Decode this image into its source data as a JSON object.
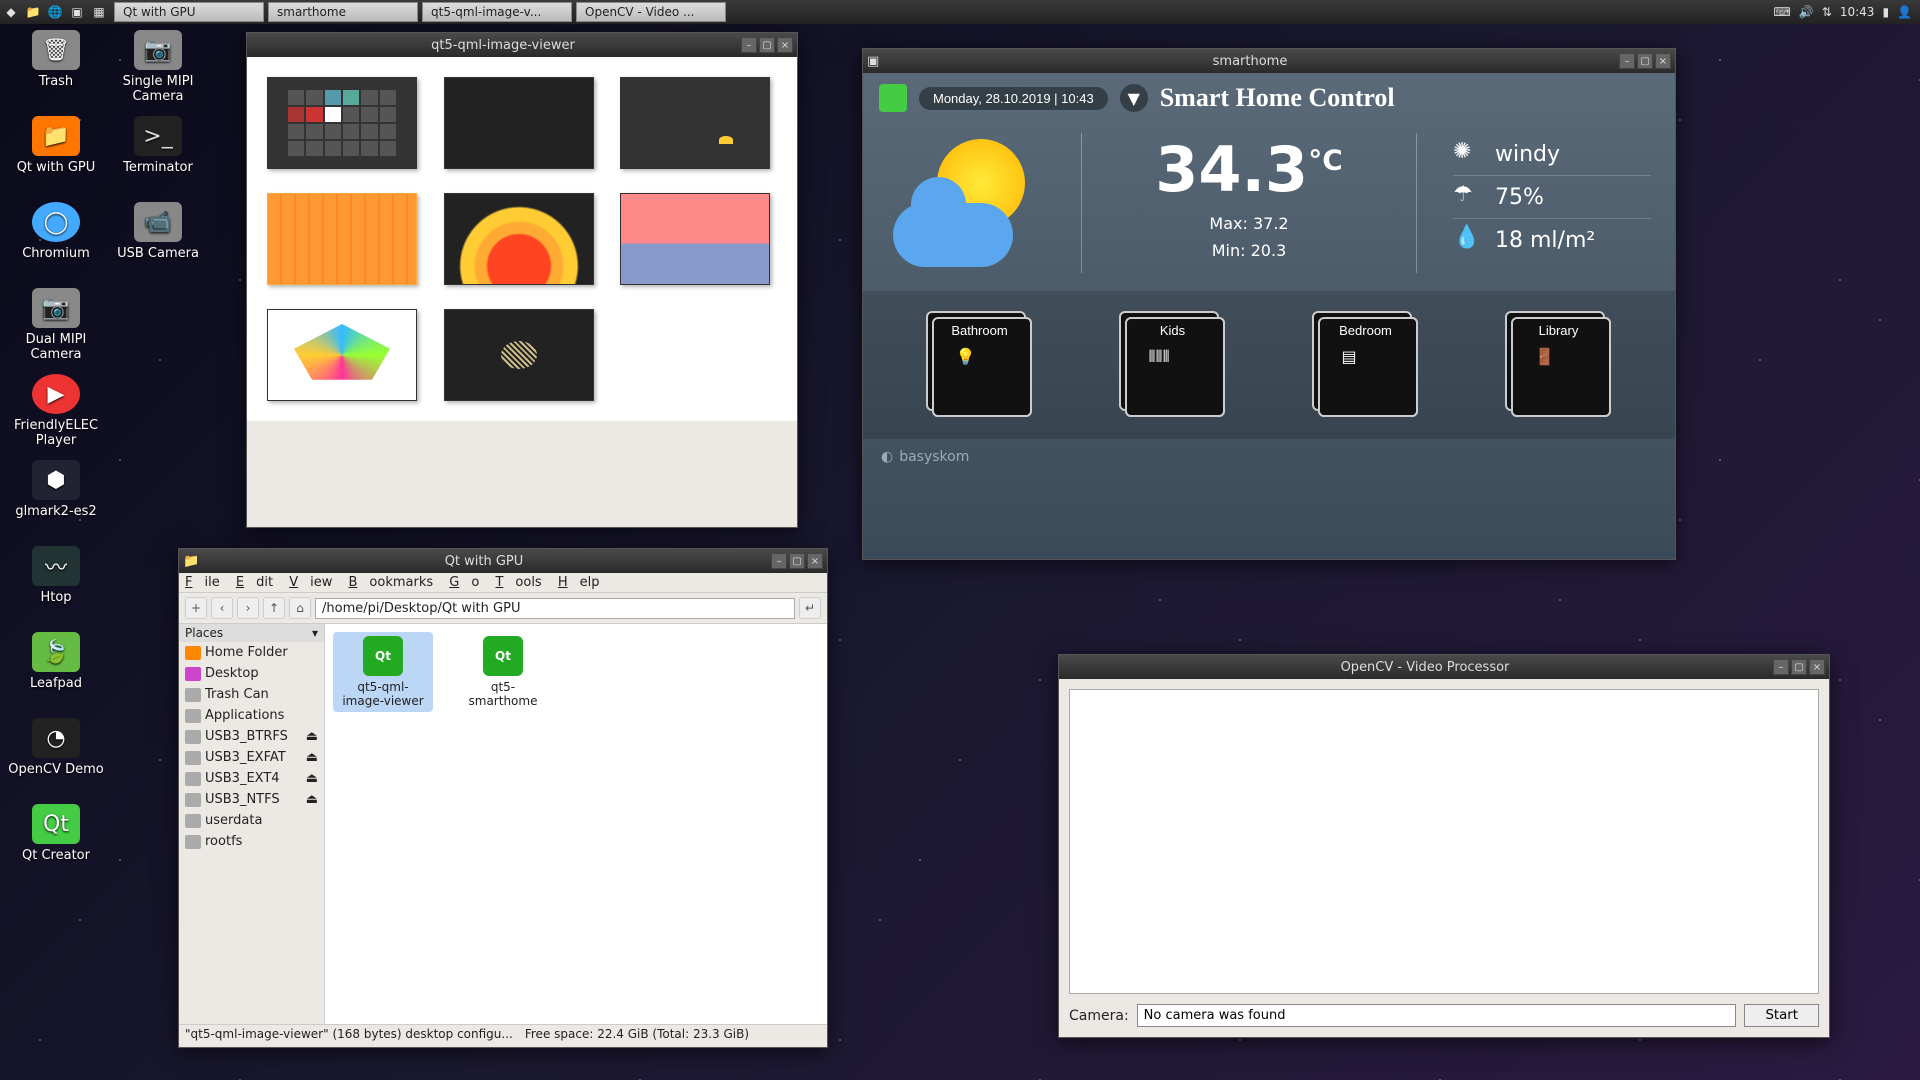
{
  "taskbar": {
    "tasks": [
      "Qt with GPU",
      "smarthome",
      "qt5-qml-image-v...",
      "OpenCV - Video ..."
    ],
    "clock": "10:43"
  },
  "desktop": {
    "icons": [
      "Trash",
      "Single MIPI Camera",
      "Qt with GPU",
      "Terminator",
      "Chromium",
      "USB Camera",
      "Dual MIPI Camera",
      "",
      "FriendlyELEC Player",
      "",
      "glmark2-es2",
      "",
      "Htop",
      "",
      "Leafpad",
      "",
      "OpenCV Demo",
      "",
      "Qt Creator",
      ""
    ]
  },
  "viewer": {
    "title": "qt5-qml-image-viewer"
  },
  "fm": {
    "title": "Qt with GPU",
    "menus": [
      "File",
      "Edit",
      "View",
      "Bookmarks",
      "Go",
      "Tools",
      "Help"
    ],
    "path": "/home/pi/Desktop/Qt with GPU",
    "places_hdr": "Places",
    "places": [
      "Home Folder",
      "Desktop",
      "Trash Can",
      "Applications",
      "USB3_BTRFS",
      "USB3_EXFAT",
      "USB3_EXT4",
      "USB3_NTFS",
      "userdata",
      "rootfs"
    ],
    "files": [
      {
        "name": "qt5-qml-image-viewer",
        "sel": true
      },
      {
        "name": "qt5-smarthome",
        "sel": false
      }
    ],
    "status_left": "\"qt5-qml-image-viewer\" (168 bytes) desktop configu...",
    "status_right": "Free space: 22.4 GiB (Total: 23.3 GiB)"
  },
  "sh": {
    "win_title": "smarthome",
    "date": "Monday, 28.10.2019 | 10:43",
    "title": "Smart Home Control",
    "temp": "34.3",
    "unit": "°C",
    "max": "Max: 37.2",
    "min": "Min: 20.3",
    "wind": "windy",
    "humidity": "75%",
    "precip": "18 ml/m²",
    "rooms": [
      "Bathroom",
      "Kids",
      "Bedroom",
      "Library"
    ],
    "footer": "basyskom"
  },
  "cv": {
    "title": "OpenCV - Video Processor",
    "cam_label": "Camera:",
    "cam_value": "No camera was found",
    "start": "Start"
  }
}
